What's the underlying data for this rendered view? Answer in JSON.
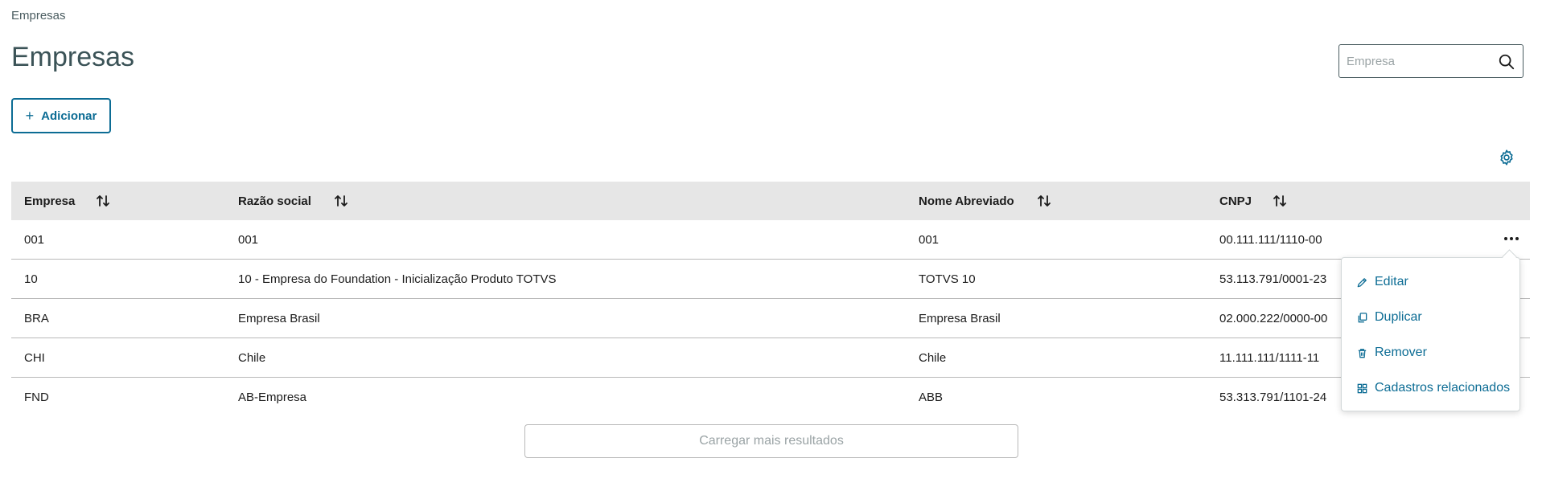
{
  "breadcrumb": "Empresas",
  "page_title": "Empresas",
  "search": {
    "placeholder": "Empresa",
    "value": ""
  },
  "actions": {
    "add_label": "Adicionar"
  },
  "table": {
    "headers": [
      "Empresa",
      "Razão social",
      "Nome Abreviado",
      "CNPJ"
    ],
    "rows": [
      [
        "001",
        "001",
        "001",
        "00.111.111/1110-00"
      ],
      [
        "10",
        "10 - Empresa do Foundation - Inicialização Produto TOTVS",
        "TOTVS 10",
        "53.113.791/0001-23"
      ],
      [
        "BRA",
        "Empresa Brasil",
        "Empresa Brasil",
        "02.000.222/0000-00"
      ],
      [
        "CHI",
        "Chile",
        "Chile",
        "11.111.111/1111-11"
      ],
      [
        "FND",
        "AB-Empresa",
        "ABB",
        "53.313.791/1101-24"
      ]
    ]
  },
  "load_more_label": "Carregar mais resultados",
  "row_menu": {
    "items": [
      {
        "label": "Editar",
        "icon": "pencil-icon"
      },
      {
        "label": "Duplicar",
        "icon": "duplicate-icon"
      },
      {
        "label": "Remover",
        "icon": "trash-icon"
      },
      {
        "label": "Cadastros relacionados",
        "icon": "grid-icon"
      }
    ]
  },
  "colors": {
    "accent": "#0c6c94",
    "header_bg": "#e6e6e6",
    "title": "#3b5357"
  }
}
